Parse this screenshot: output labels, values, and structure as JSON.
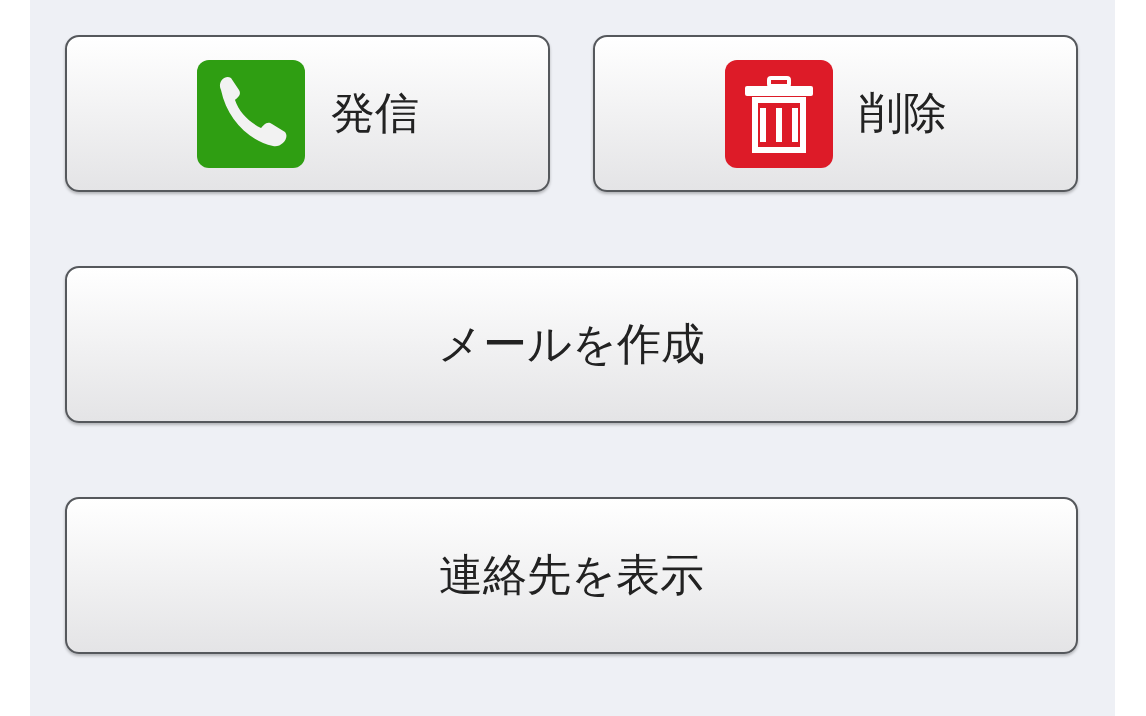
{
  "rows": [
    {
      "buttons": [
        {
          "label": "発信",
          "kind": "call"
        },
        {
          "label": "削除",
          "kind": "delete"
        }
      ]
    },
    {
      "buttons": [
        {
          "label": "メールを作成",
          "kind": "plain"
        }
      ]
    },
    {
      "buttons": [
        {
          "label": "連絡先を表示",
          "kind": "plain"
        }
      ]
    }
  ]
}
